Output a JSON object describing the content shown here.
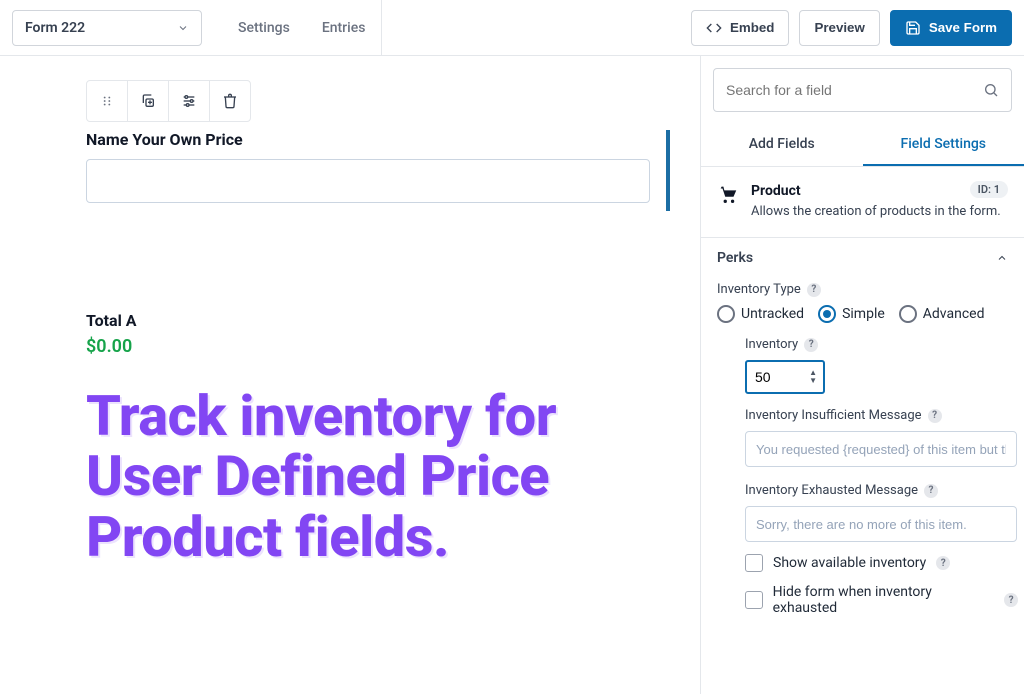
{
  "header": {
    "form_name": "Form 222",
    "tabs": {
      "settings": "Settings",
      "entries": "Entries"
    },
    "buttons": {
      "embed": "Embed",
      "preview": "Preview",
      "save": "Save Form"
    }
  },
  "canvas": {
    "field_label": "Name Your Own Price",
    "total_label": "Total A",
    "total_value": "$0.00",
    "headline_l1": "Track inventory for",
    "headline_l2": "User Defined Price",
    "headline_l3": "Product fields."
  },
  "sidebar": {
    "search_placeholder": "Search for a field",
    "tabs": {
      "add": "Add Fields",
      "settings": "Field Settings"
    },
    "product": {
      "title": "Product",
      "desc": "Allows the creation of products in the form.",
      "id_badge": "ID: 1"
    },
    "perks_section": "Perks",
    "inventory_type_label": "Inventory Type",
    "inventory_type_options": {
      "untracked": "Untracked",
      "simple": "Simple",
      "advanced": "Advanced"
    },
    "inventory_label": "Inventory",
    "inventory_value": "50",
    "insufficient_label": "Inventory Insufficient Message",
    "insufficient_placeholder": "You requested {requested} of this item but ther",
    "exhausted_label": "Inventory Exhausted Message",
    "exhausted_placeholder": "Sorry, there are no more of this item.",
    "show_available": "Show available inventory",
    "hide_form": "Hide form when inventory exhausted"
  }
}
